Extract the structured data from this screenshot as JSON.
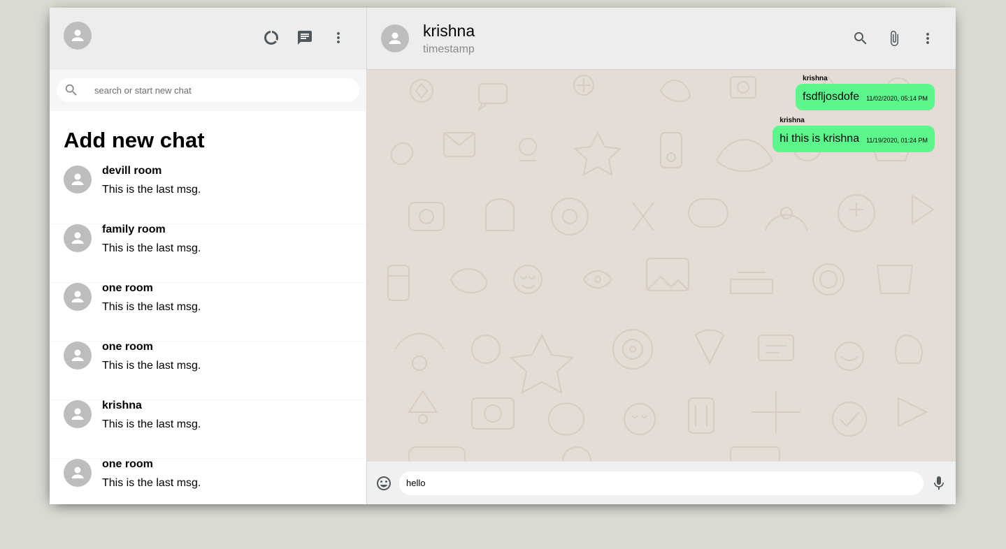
{
  "sidebar": {
    "search_placeholder": "search or start new chat",
    "add_new_chat": "Add new chat",
    "chats": [
      {
        "name": "devill room",
        "last": "This is the last msg."
      },
      {
        "name": "family room",
        "last": "This is the last msg."
      },
      {
        "name": "one room",
        "last": "This is the last msg."
      },
      {
        "name": "one room",
        "last": "This is the last msg."
      },
      {
        "name": "krishna",
        "last": "This is the last msg."
      },
      {
        "name": "one room",
        "last": "This is the last msg."
      }
    ]
  },
  "chat": {
    "name": "krishna",
    "timestamp": "timestamp",
    "messages": [
      {
        "sender": "krishna",
        "text": "fsdfljosdofe",
        "time": "11/02/2020, 05:14 PM"
      },
      {
        "sender": "krishna",
        "text": "hi this is krishna",
        "time": "11/19/2020, 01:24 PM"
      }
    ],
    "input_value": "hello"
  },
  "colors": {
    "bubble": "#5cf78c",
    "header": "#ededed",
    "chat_bg": "#e5ddd5",
    "page_bg": "#dadbd3"
  },
  "icons": {
    "sidebar_header": [
      "avatar-icon",
      "status-icon",
      "new-chat-icon",
      "more-vert-icon"
    ],
    "chat_header": [
      "avatar-icon",
      "search-icon",
      "attach-icon",
      "more-vert-icon"
    ],
    "footer": [
      "emoji-icon",
      "mic-icon"
    ],
    "search": "search-icon"
  }
}
